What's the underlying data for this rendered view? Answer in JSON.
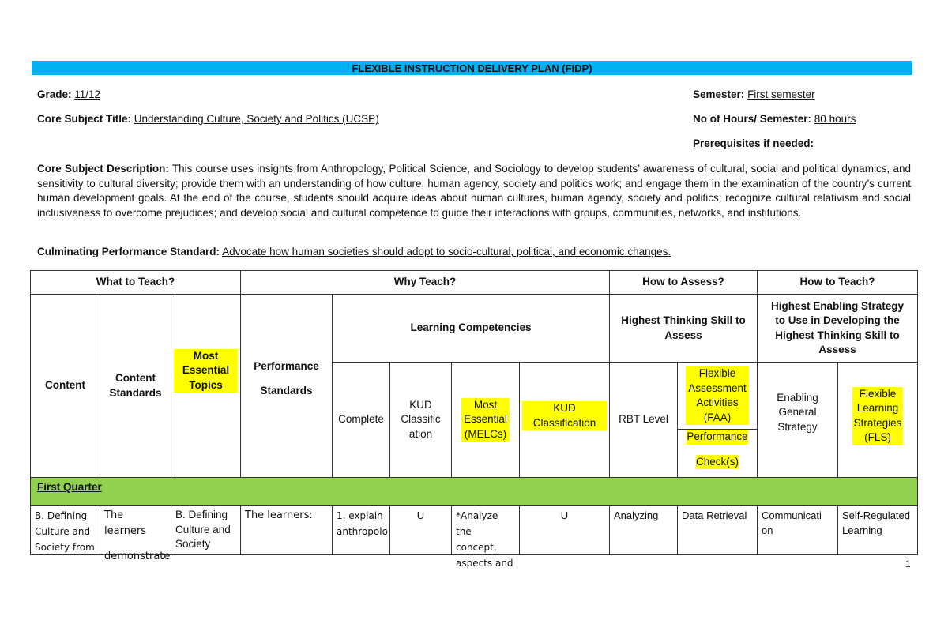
{
  "document": {
    "title": "FLEXIBLE INSTRUCTION DELIVERY PLAN (FIDP)",
    "grade_label": "Grade:",
    "grade_value": "11/12",
    "semester_label": "Semester:",
    "semester_value": "First semester",
    "subject_title_label": "Core Subject Title:",
    "subject_title_value": "Understanding Culture, Society and Politics (UCSP)",
    "hours_label": "No of Hours/ Semester:",
    "hours_value": "80 hours",
    "prerequisites_label": "Prerequisites if needed:",
    "description_label": "Core Subject Description:",
    "description_value": "This course uses insights from Anthropology, Political Science, and Sociology to develop students’ awareness of cultural, social and political dynamics, and sensitivity to cultural diversity; provide them with an understanding of how culture, human agency, society and politics work; and engage them in the examination of the country’s current human development goals. At the end of the course, students should acquire ideas about human cultures, human agency, society and politics; recognize cultural relativism and social inclusiveness to overcome prejudices; and develop social and cultural competence to guide their interactions with groups, communities, networks, and institutions.",
    "culminating_label": "Culminating Performance Standard:",
    "culminating_value": "Advocate how human societies should adopt to socio-cultural, political, and economic changes.",
    "page_number": "1"
  },
  "table": {
    "groups": {
      "what": "What to Teach?",
      "why": "Why Teach?",
      "assess": "How to Assess?",
      "teach": "How to Teach?"
    },
    "subgroups": {
      "learning_competencies": "Learning Competencies",
      "highest_thinking": "Highest Thinking Skill to Assess",
      "highest_enabling": "Highest Enabling Strategy to Use in Developing the Highest Thinking Skill to Assess"
    },
    "headers": {
      "content": "Content",
      "content_standards": "Content Standards",
      "most_essential_topics": "Most Essential Topics",
      "performance_standards_1": "Performance",
      "performance_standards_2": "Standards",
      "complete": "Complete",
      "kud_classification_1": "KUD Classific ation",
      "most_essential_melcs": "Most Essential (MELCs)",
      "kud_classification_2": "KUD Classification",
      "rbt_level": "RBT Level",
      "faa": "Flexible Assessment Activities (FAA)",
      "performance_check_1": "Performance",
      "performance_check_2": "Check(s)",
      "enabling_general_strategy": "Enabling General Strategy",
      "fls": "Flexible Learning Strategies (FLS)"
    },
    "quarter_label": "First Quarter",
    "rows": [
      {
        "content": "B. Defining Culture and Society from",
        "content_standards_1": "The learners",
        "content_standards_2": "demonstrate",
        "most_essential_topics": "B. Defining Culture and Society",
        "performance_standards": "The learners:",
        "complete": "1. explain anthropolo",
        "kud_1": "U",
        "melcs": "*Analyze the concept, aspects and",
        "kud_2": "U",
        "rbt_level": "Analyzing",
        "faa": "Data Retrieval",
        "enabling_strategy": "Communicati on",
        "fls": "Self-Regulated Learning"
      }
    ]
  }
}
